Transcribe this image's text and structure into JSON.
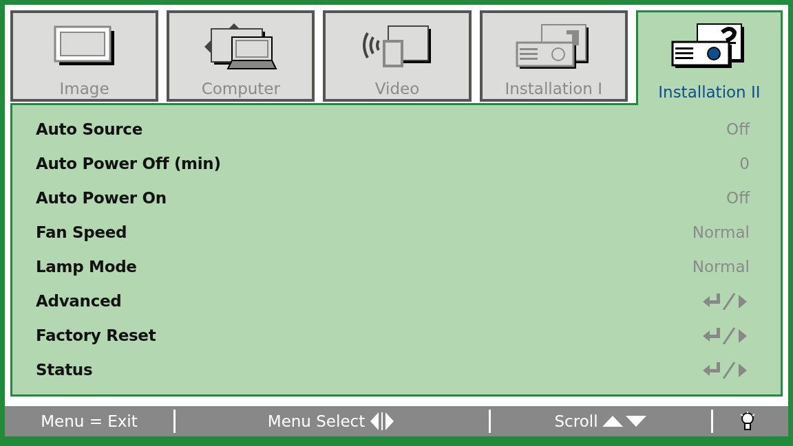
{
  "tabs": [
    {
      "label": "Image",
      "selected": false
    },
    {
      "label": "Computer",
      "selected": false
    },
    {
      "label": "Video",
      "selected": false
    },
    {
      "label": "Installation I",
      "selected": false
    },
    {
      "label": "Installation II",
      "selected": true
    }
  ],
  "settings": [
    {
      "label": "Auto Source",
      "kind": "value",
      "value": "Off"
    },
    {
      "label": "Auto Power Off (min)",
      "kind": "value",
      "value": "0"
    },
    {
      "label": "Auto Power On",
      "kind": "value",
      "value": "Off"
    },
    {
      "label": "Fan Speed",
      "kind": "value",
      "value": "Normal"
    },
    {
      "label": "Lamp Mode",
      "kind": "value",
      "value": "Normal"
    },
    {
      "label": "Advanced",
      "kind": "submenu"
    },
    {
      "label": "Factory Reset",
      "kind": "submenu"
    },
    {
      "label": "Status",
      "kind": "submenu"
    }
  ],
  "footer": [
    {
      "label": "Menu = Exit",
      "kind": "text"
    },
    {
      "label": "Menu Select",
      "kind": "left-right"
    },
    {
      "label": "Scroll",
      "kind": "up-down"
    },
    {
      "kind": "lamp"
    }
  ]
}
